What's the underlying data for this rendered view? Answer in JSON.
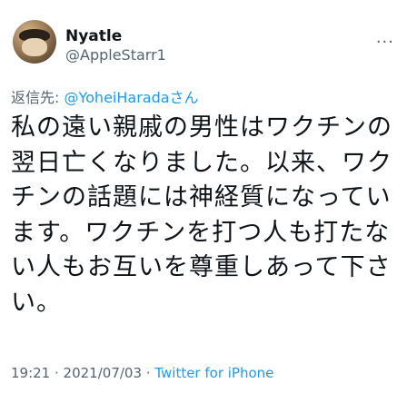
{
  "tweet": {
    "display_name": "Nyatle",
    "handle": "@AppleStarr1",
    "more_icon": "more-horizontal-icon",
    "reply_prefix": "返信先: ",
    "reply_mention": "@YoheiHaradaさん",
    "body": "私の遠い親戚の男性はワクチンの翌日亡くなりました。以来、ワクチンの話題には神経質になっています。ワクチンを打つ人も打たない人もお互いを尊重しあって下さい。",
    "time": "19:21",
    "separator": " · ",
    "date": "2021/07/03",
    "source": "Twitter for iPhone"
  },
  "colors": {
    "text": "#0f1419",
    "secondary": "#536471",
    "accent": "#1d9bf0"
  }
}
